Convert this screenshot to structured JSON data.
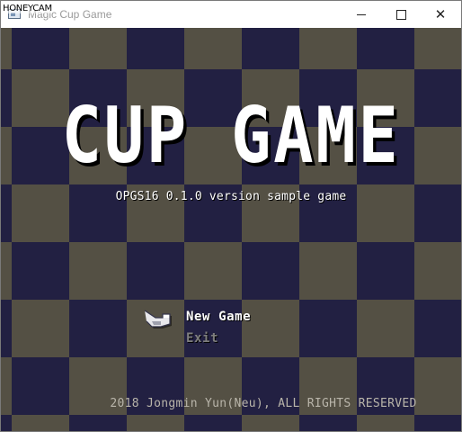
{
  "window": {
    "title": "Magic Cup Game",
    "watermark": "HONEYCAM"
  },
  "game": {
    "logo": "CUP GAME",
    "subtitle": "OPGS16 0.1.0 version sample game",
    "menu": {
      "items": [
        {
          "label": "New Game",
          "selected": true
        },
        {
          "label": "Exit",
          "selected": false
        }
      ],
      "cursor_icon": "pointing-hand-icon"
    },
    "copyright": "2018 Jongmin Yun(Neu), ALL RIGHTS RESERVED"
  },
  "colors": {
    "checker_dark": "#222042",
    "checker_light": "#545044",
    "menu_selected": "#ffffff",
    "menu_unselected": "#7e7e7e"
  }
}
